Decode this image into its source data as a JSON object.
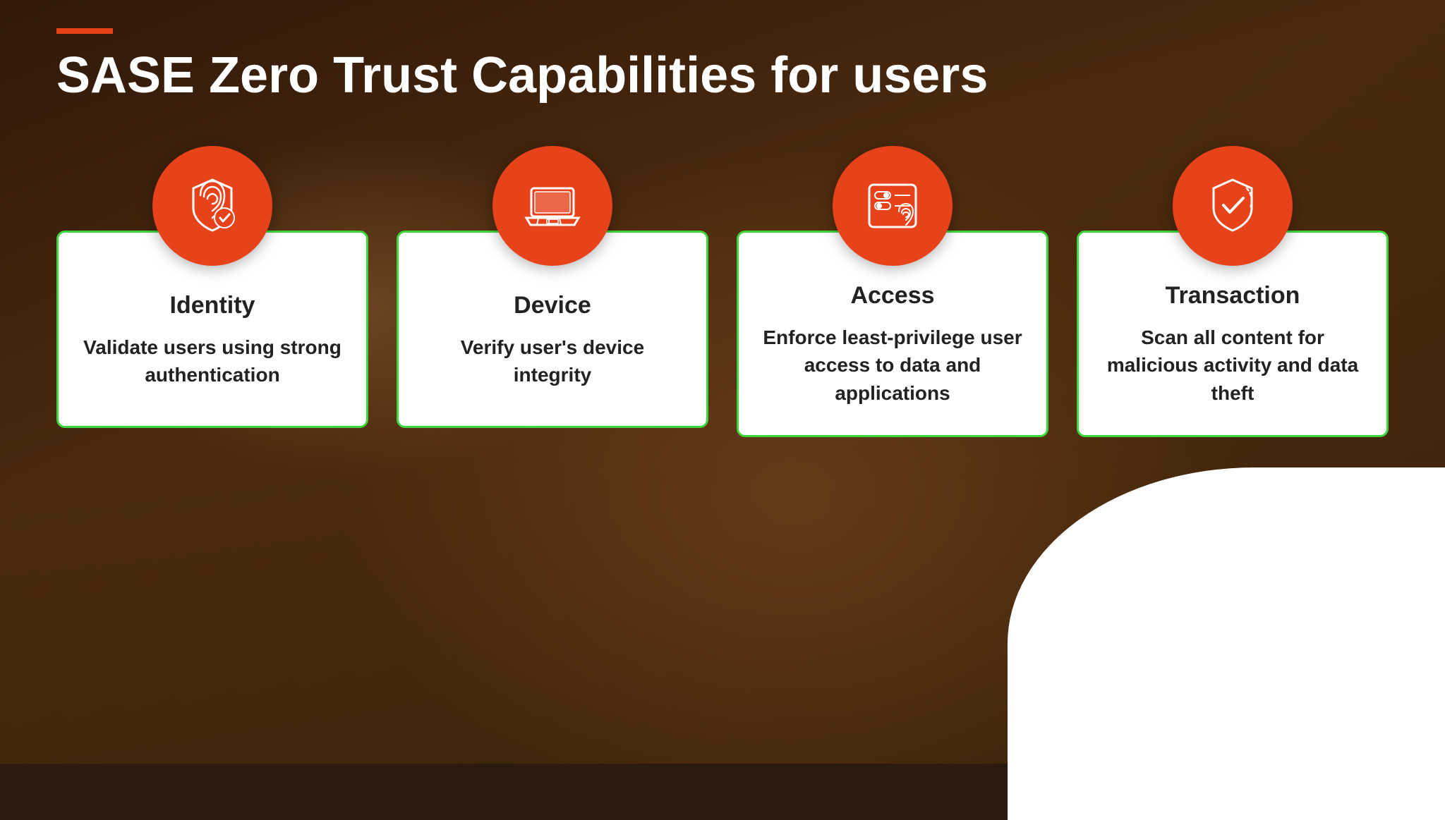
{
  "accent": "#e8421a",
  "green_border": "#3dd63d",
  "title": "SASE Zero Trust Capabilities for users",
  "capabilities": [
    {
      "id": "identity",
      "category": "Identity",
      "description": "Validate users using strong authentication",
      "icon": "fingerprint-shield"
    },
    {
      "id": "device",
      "category": "Device",
      "description": "Verify user's device integrity",
      "icon": "laptop"
    },
    {
      "id": "access",
      "category": "Access",
      "description": "Enforce least-privilege user access to data and applications",
      "icon": "fingerprint-settings"
    },
    {
      "id": "transaction",
      "category": "Transaction",
      "description": "Scan all content for malicious activity and data theft",
      "icon": "shield-check"
    }
  ]
}
